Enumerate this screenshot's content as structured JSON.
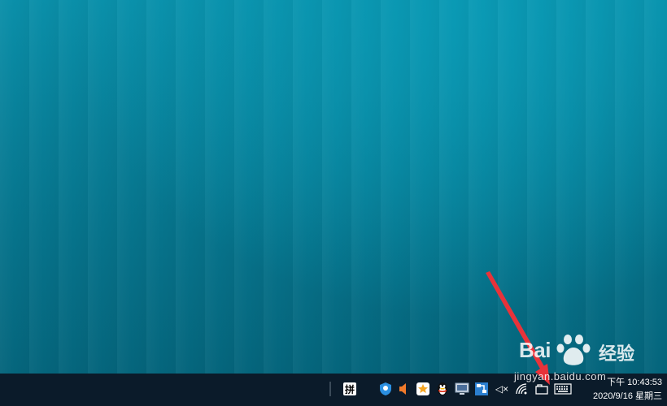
{
  "desktop": {
    "wallpaper_colors": {
      "top": "#0a8fa9",
      "bottom": "#05657c"
    }
  },
  "taskbar": {
    "background": "#0b1b2a",
    "tray": {
      "ime_label": "拼",
      "icons": [
        "security-shield-icon",
        "speaker-orange-icon",
        "star-app-icon",
        "qq-penguin-icon",
        "display-icon",
        "network-app-icon",
        "volume-muted-icon",
        "wifi-icon",
        "keyboard-folder-icon",
        "touch-keyboard-icon"
      ],
      "volume_muted_label": "◁×"
    },
    "clock": {
      "time": "下午 10:43:53",
      "date": "2020/9/16 星期三"
    }
  },
  "annotation": {
    "arrow_color": "#e8333a"
  },
  "watermark": {
    "brand": "Bai",
    "brand_cn": "经验",
    "url": "jingyan.baidu.com"
  }
}
